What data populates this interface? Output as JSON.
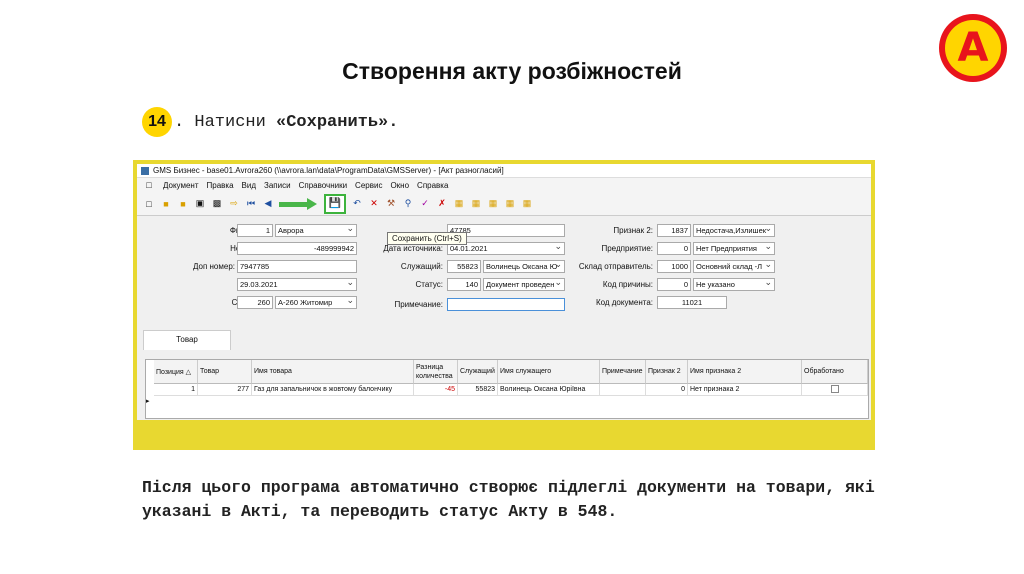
{
  "slide": {
    "title": "Створення акту розбіжностей",
    "step_number": "14",
    "step_prefix": ". Натисни ",
    "step_bold": "«Сохранить».",
    "description": "Після цього програма автоматично створює підлеглі документи на товари, які указані в Акті, та переводить статус Акту в 548."
  },
  "logo": {
    "letter": "А",
    "colors": {
      "outer": "#e8141c",
      "inner": "#ffd500"
    }
  },
  "app": {
    "title": "GMS Бизнес - base01.Avrora260 (\\\\avrora.lan\\data\\ProgramData\\GMSServer) - [Акт разногласий]",
    "menu": [
      "Документ",
      "Правка",
      "Вид",
      "Записи",
      "Справочники",
      "Сервис",
      "Окно",
      "Справка"
    ],
    "tooltip": "Сохранить (Ctrl+S)",
    "toolbar_icons": [
      "new-icon",
      "open-icon",
      "folder-icon",
      "preview-icon",
      "print-icon",
      "export-icon",
      "first-icon",
      "prev-icon",
      "save-icon",
      "undo-icon",
      "delete-icon",
      "tools-icon",
      "search-icon",
      "approve-icon",
      "reject-icon",
      "report-icon"
    ],
    "form": {
      "firm_label": "Фирма:",
      "firm_code": "1",
      "firm_name": "Аврора",
      "number_label": "Номер:",
      "number_value": "-489999942",
      "ext_number_label": "Доп номер:",
      "ext_number_value": "7947785",
      "date_label": "Дата:",
      "date_value": "29.03.2021",
      "warehouse_label": "Склад:",
      "warehouse_code": "260",
      "warehouse_name": "А-260 Житомир",
      "source_number_value": "47785",
      "source_date_label": "Дата источника:",
      "source_date_value": "04.01.2021",
      "employee_label": "Служащий:",
      "employee_code": "55823",
      "employee_name": "Волинець Оксана Ю",
      "status_label": "Статус:",
      "status_code": "140",
      "status_name": "Документ проведен",
      "note_label": "Примечание:",
      "note_value": "",
      "sign2_label": "Признак 2:",
      "sign2_code": "1837",
      "sign2_name": "Недостача,Излишек",
      "enterprise_label": "Предприятие:",
      "enterprise_code": "0",
      "enterprise_name": "Нет Предприятия",
      "sender_wh_label": "Склад отправитель:",
      "sender_wh_code": "1000",
      "sender_wh_name": "Основний склад -Л",
      "reason_label": "Код причины:",
      "reason_code": "0",
      "reason_name": "Не указано",
      "doc_code_label": "Код документа:",
      "doc_code_value": "11021"
    },
    "tab_label": "Товар",
    "grid": {
      "headers": [
        "Позиция △",
        "Товар",
        "Имя товара",
        "Разница количества",
        "Служащий",
        "Имя служащего",
        "Примечание",
        "Признак 2",
        "Имя признака 2",
        "Обработано"
      ],
      "rows": [
        [
          "1",
          "277",
          "Газ для запальничок в жовтому балончику",
          "-45",
          "55823",
          "Волинець Оксана Юріївна",
          "",
          "0",
          "Нет признака 2",
          ""
        ]
      ]
    }
  }
}
